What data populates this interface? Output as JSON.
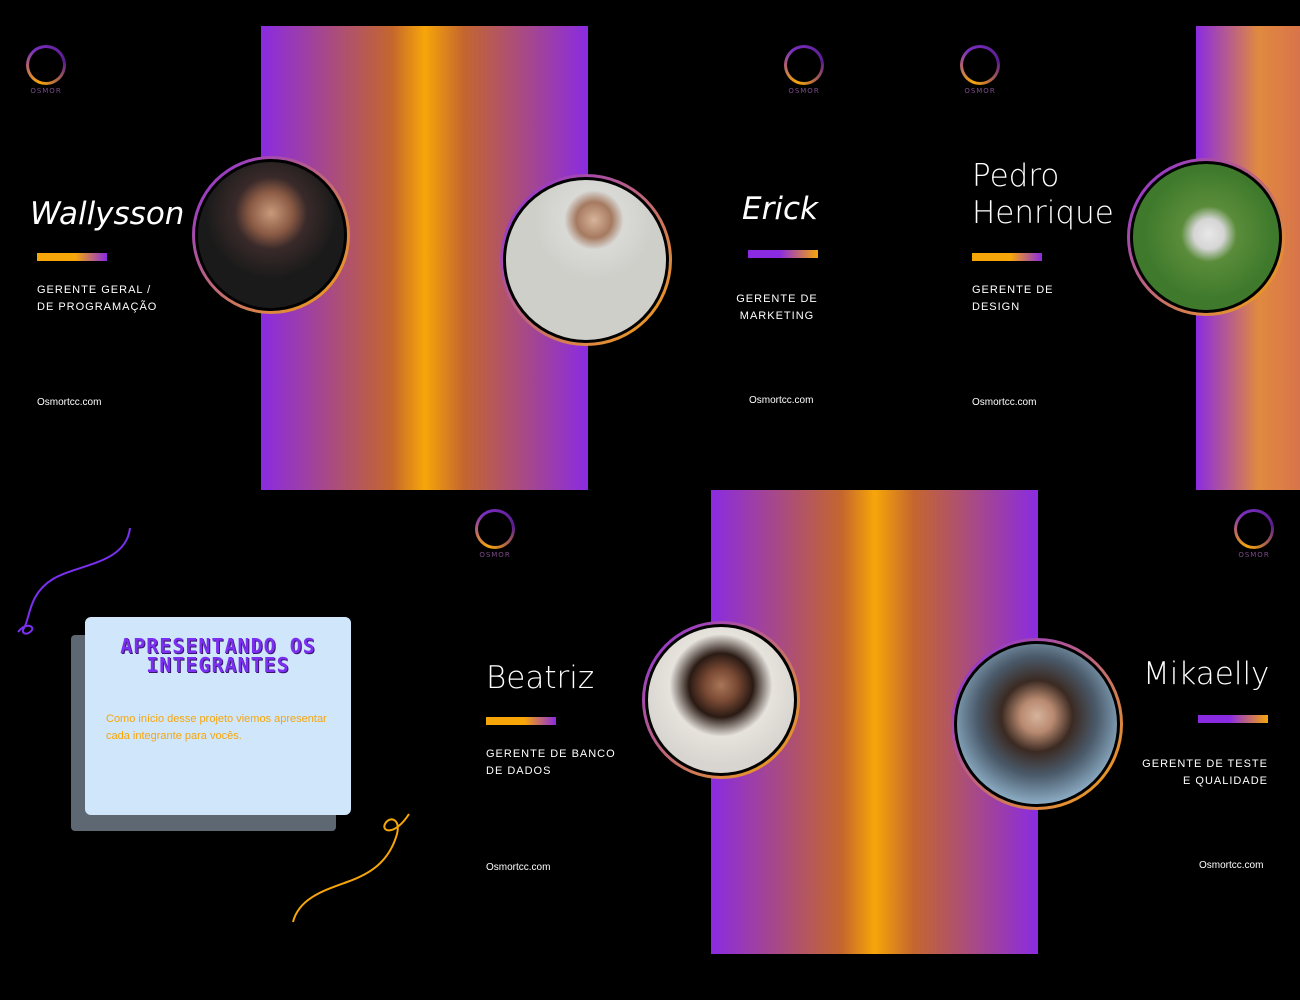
{
  "logo_text": "OSMOR",
  "site": "Osmortcc.com",
  "intro": {
    "title": "APRESENTANDO OS INTEGRANTES",
    "description": "Como início desse projeto viemos apresentar cada integrante para vocês."
  },
  "members": [
    {
      "name": "Wallysson",
      "role_line1": "GERENTE GERAL /",
      "role_line2": "DE PROGRAMAÇÃO"
    },
    {
      "name": "Erick",
      "role_line1": "GERENTE  DE",
      "role_line2": "MARKETING"
    },
    {
      "name_line1": "Pedro",
      "name_line2": "Henrique",
      "role_line1": "GERENTE DE",
      "role_line2": "DESIGN"
    },
    {
      "name": "Beatriz",
      "role_line1": "GERENTE DE BANCO",
      "role_line2": "DE DADOS"
    },
    {
      "name": "Mikaelly",
      "role_line1": "GERENTE  DE TESTE",
      "role_line2": "E QUALIDADE"
    }
  ],
  "colors": {
    "purple": "#8a2be2",
    "orange": "#f7a609",
    "card": "#cfe6fb",
    "shadow": "#5d6873"
  },
  "icons": [
    "osmor-logo-icon",
    "person-photo",
    "decorative-curve"
  ]
}
